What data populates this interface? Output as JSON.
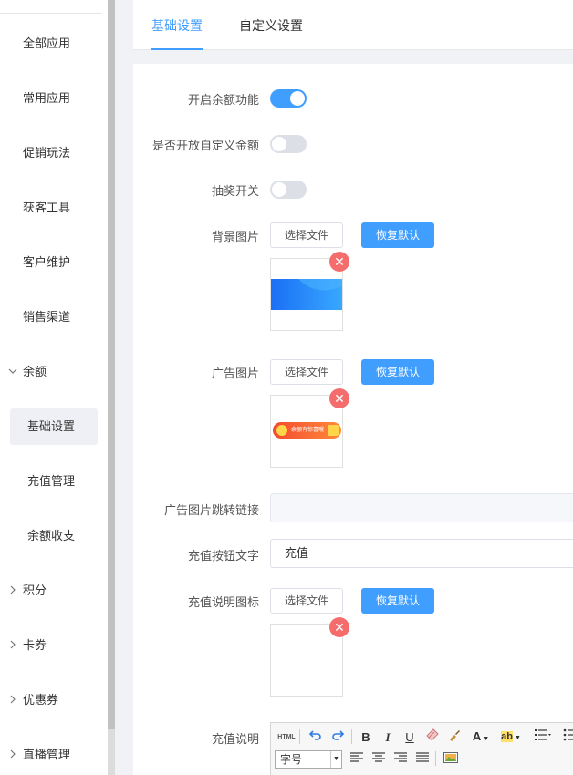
{
  "sidebar": {
    "items": [
      {
        "label": "全部应用"
      },
      {
        "label": "常用应用"
      },
      {
        "label": "促销玩法"
      },
      {
        "label": "获客工具"
      },
      {
        "label": "客户维护"
      },
      {
        "label": "销售渠道"
      },
      {
        "label": "余额",
        "expanded": true
      },
      {
        "label": "基础设置",
        "active": true
      },
      {
        "label": "充值管理"
      },
      {
        "label": "余额收支"
      },
      {
        "label": "积分"
      },
      {
        "label": "卡券"
      },
      {
        "label": "优惠券"
      },
      {
        "label": "直播管理"
      }
    ]
  },
  "tabs": [
    {
      "label": "基础设置",
      "active": true
    },
    {
      "label": "自定义设置"
    }
  ],
  "form": {
    "balance_enable": {
      "label": "开启余额功能",
      "on": true
    },
    "custom_amount": {
      "label": "是否开放自定义金额",
      "on": false
    },
    "lottery": {
      "label": "抽奖开关",
      "on": false
    },
    "bg_image": {
      "label": "背景图片",
      "choose": "选择文件",
      "reset": "恢复默认"
    },
    "ad_image": {
      "label": "广告图片",
      "choose": "选择文件",
      "reset": "恢复默认",
      "banner_text": "余额有惊喜哦"
    },
    "ad_link": {
      "label": "广告图片跳转链接",
      "value": ""
    },
    "recharge_btn": {
      "label": "充值按钮文字",
      "value": "充值"
    },
    "recharge_icon": {
      "label": "充值说明图标",
      "choose": "选择文件",
      "reset": "恢复默认"
    },
    "recharge_desc": {
      "label": "充值说明"
    }
  },
  "editor": {
    "html_label": "HTML",
    "font_size_select": "字号",
    "tools": [
      "undo",
      "redo",
      "bold",
      "italic",
      "underline",
      "eraser",
      "format-brush",
      "font-color",
      "highlight",
      "ordered-list",
      "unordered-list",
      "align-left",
      "align-center",
      "align-right",
      "align-justify",
      "image"
    ],
    "bold": "B",
    "italic": "I",
    "underline": "U",
    "font_color": "A",
    "highlight": "ab"
  },
  "colors": {
    "accent": "#409eff",
    "danger": "#f56c6c",
    "switch_off": "#dcdfe6"
  }
}
